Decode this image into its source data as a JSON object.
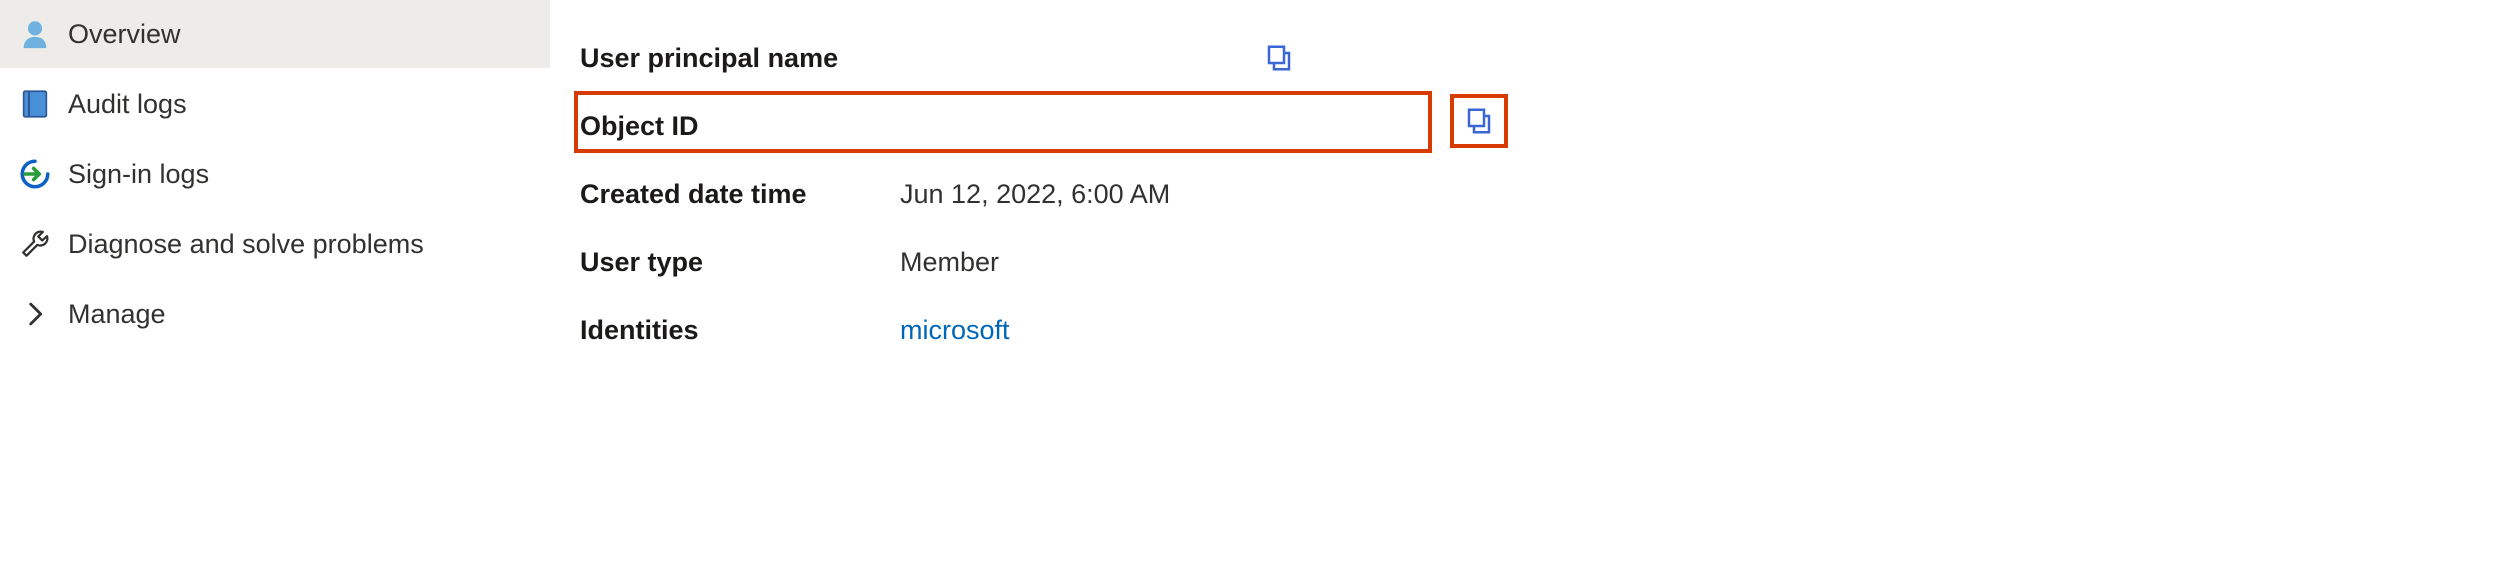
{
  "sidebar": {
    "items": [
      {
        "label": "Overview"
      },
      {
        "label": "Audit logs"
      },
      {
        "label": "Sign-in logs"
      },
      {
        "label": "Diagnose and solve problems"
      },
      {
        "label": "Manage"
      }
    ]
  },
  "properties": {
    "user_principal_name_label": "User principal name",
    "user_principal_name_value": "",
    "object_id_label": "Object ID",
    "object_id_value": "",
    "created_date_time_label": "Created date time",
    "created_date_time_value": "Jun 12, 2022, 6:00 AM",
    "user_type_label": "User type",
    "user_type_value": "Member",
    "identities_label": "Identities",
    "identities_value": "microsoft"
  },
  "colors": {
    "highlight": "#d83b01",
    "link": "#0067b8",
    "active_bg": "#eeece9"
  }
}
